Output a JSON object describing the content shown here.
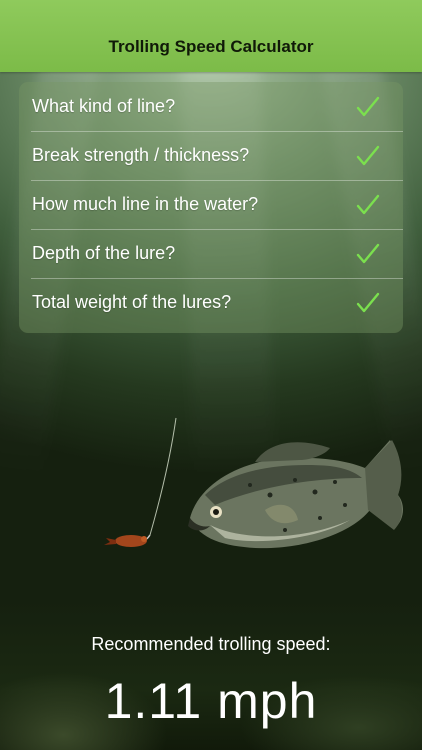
{
  "header": {
    "title": "Trolling Speed Calculator"
  },
  "menu": {
    "items": [
      {
        "label": "What kind of line?",
        "icon": "checkmark-icon",
        "completed": true
      },
      {
        "label": "Break strength / thickness?",
        "icon": "checkmark-icon",
        "completed": true
      },
      {
        "label": "How much line in the water?",
        "icon": "checkmark-icon",
        "completed": true
      },
      {
        "label": "Depth of the lure?",
        "icon": "checkmark-icon",
        "completed": true
      },
      {
        "label": "Total weight of the lures?",
        "icon": "checkmark-icon",
        "completed": true
      }
    ]
  },
  "result": {
    "label": "Recommended trolling speed:",
    "value": "1.11 mph"
  },
  "colors": {
    "header_green": "#85c452",
    "check_green": "#7be04e",
    "water_dark": "#1f2f18"
  }
}
